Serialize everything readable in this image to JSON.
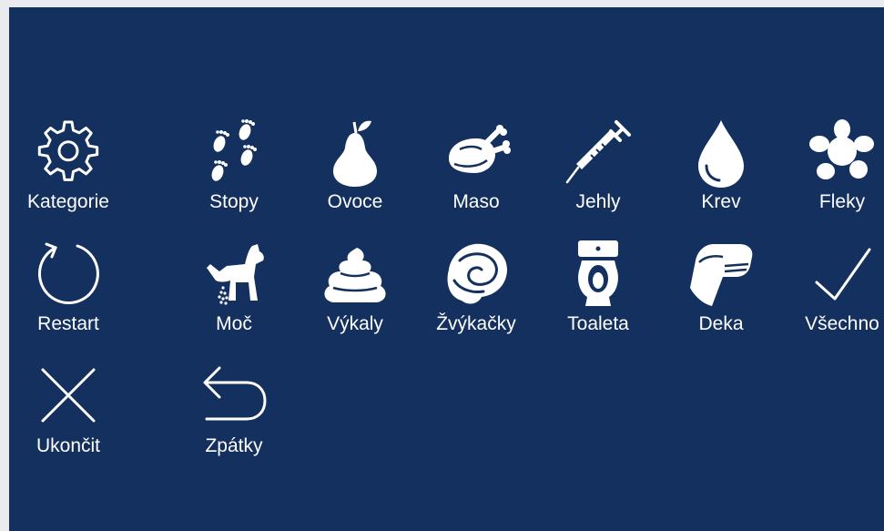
{
  "theme": {
    "background": "#13305f",
    "foreground": "#ffffff",
    "margin": "#e9ebef"
  },
  "menu": {
    "categories": {
      "label": "Kategorie",
      "icon": "gear-icon"
    },
    "restart": {
      "label": "Restart",
      "icon": "restart-arrow-icon"
    },
    "quit": {
      "label": "Ukončit",
      "icon": "close-x-icon"
    },
    "back": {
      "label": "Zpátky",
      "icon": "back-arrow-icon"
    }
  },
  "items": {
    "stopy": {
      "label": "Stopy",
      "icon": "footprints-icon"
    },
    "ovoce": {
      "label": "Ovoce",
      "icon": "pear-icon"
    },
    "maso": {
      "label": "Maso",
      "icon": "roast-chicken-icon"
    },
    "jehly": {
      "label": "Jehly",
      "icon": "syringe-icon"
    },
    "krev": {
      "label": "Krev",
      "icon": "blood-drop-icon"
    },
    "fleky": {
      "label": "Fleky",
      "icon": "stain-icon"
    },
    "moc": {
      "label": "Moč",
      "icon": "peeing-dog-icon"
    },
    "vykaly": {
      "label": "Výkaly",
      "icon": "feces-icon"
    },
    "zvykacky": {
      "label": "Žvýkačky",
      "icon": "chewing-gum-icon"
    },
    "toaleta": {
      "label": "Toaleta",
      "icon": "toilet-icon"
    },
    "deka": {
      "label": "Deka",
      "icon": "blanket-icon"
    },
    "vsechno": {
      "label": "Všechno",
      "icon": "checkmark-icon"
    }
  }
}
